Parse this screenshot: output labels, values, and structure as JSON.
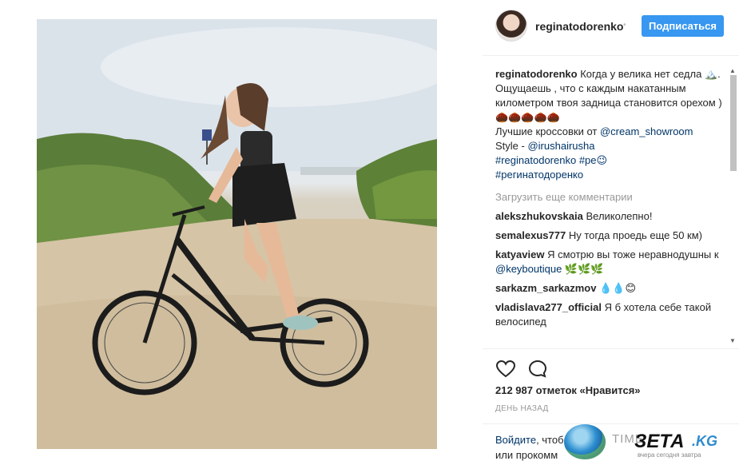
{
  "post": {
    "username": "reginatodorenko",
    "verified_dot": "•",
    "follow_label": "Подписаться",
    "caption_user": "reginatodorenko",
    "caption_text": "Когда у велика нет седла 🏔️. Ощущаешь , что с каждым накатанным километром твоя задница становится орехом )🌰🌰🌰🌰🌰",
    "caption_line2": "Лучшие кроссовки от ",
    "caption_link1": "@cream_showroom",
    "caption_line3": "Style - ",
    "caption_link2": "@irushairusha",
    "hashtag1": "#reginatodorenko",
    "hashtag2": "#ре😉",
    "hashtag3": "#регинатодоренко",
    "load_more": "Загрузить еще комментарии"
  },
  "comments": [
    {
      "user": "alekszhukovskaia",
      "text": "Великолепно!"
    },
    {
      "user": "semalexus777",
      "text": "Ну тогда проедь еще 50 км)"
    },
    {
      "user": "katyaview",
      "text": "Я смотрю вы тоже неравнодушны к ",
      "link": "@keyboutique",
      "after": " 🌿🌿🌿"
    },
    {
      "user": "sarkazm_sarkazmov",
      "text": "💧💧😊"
    },
    {
      "user": "vladislava277_official",
      "text": "Я б хотела себе такой велосипед"
    }
  ],
  "actions": {
    "heart_icon": "heart-icon",
    "comment_icon": "comment-icon",
    "likes": "212 987 отметок «Нравится»",
    "time": "ДЕНЬ НАЗАД"
  },
  "login": {
    "link": "Войдите",
    "text": ", чтоб",
    "line2": "или прокомм"
  },
  "watermark": {
    "time": "TIME",
    "brand": "ЗЕТА",
    "tld": ".KG",
    "tag": "вчера сегодня завтра"
  }
}
